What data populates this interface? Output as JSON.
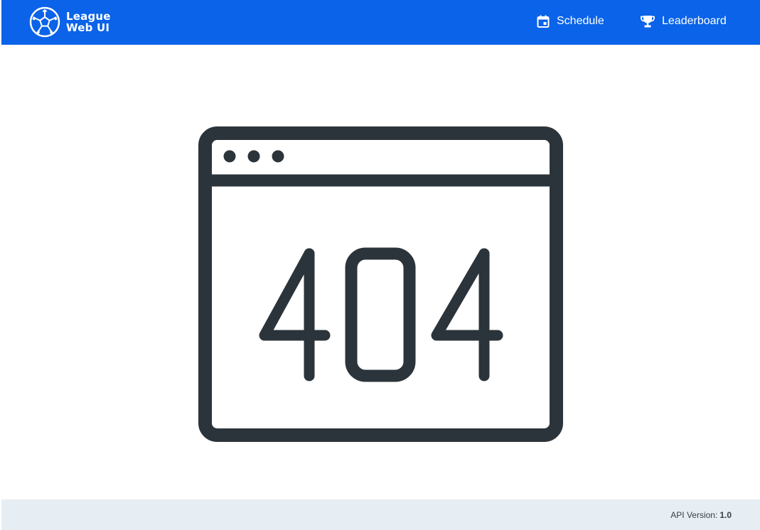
{
  "header": {
    "brand": {
      "line1": "League",
      "line2": "Web UI",
      "logo_icon": "soccer-ball-icon"
    },
    "nav": [
      {
        "label": "Schedule",
        "icon": "calendar-icon"
      },
      {
        "label": "Leaderboard",
        "icon": "trophy-icon"
      }
    ],
    "background_color": "#0a63e8"
  },
  "main": {
    "error_code": "404",
    "illustration": "browser-window-404-icon",
    "stroke_color": "#2b343a"
  },
  "footer": {
    "api_version_label": "API Version:",
    "api_version_value": "1.0",
    "background_color": "#e6edf3"
  }
}
